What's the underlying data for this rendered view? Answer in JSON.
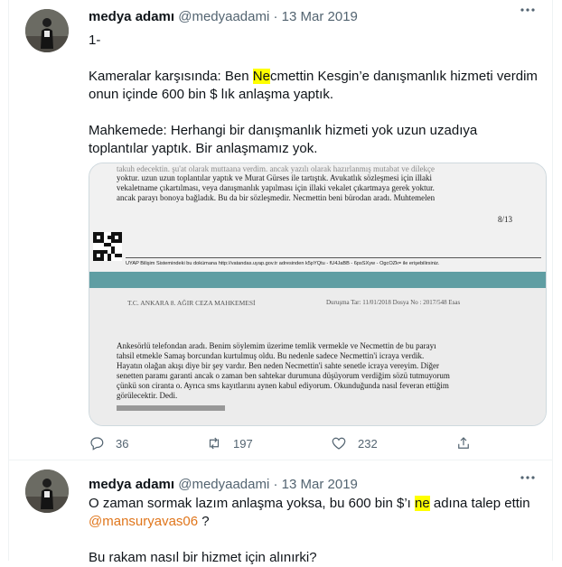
{
  "tweets": [
    {
      "author_name": "medya adamı",
      "author_handle": "@medyaadami",
      "separator": "·",
      "date": "13 Mar 2019",
      "line1": "1-",
      "para1_pre": "Kameralar karşısında: Ben ",
      "para1_hl": "Ne",
      "para1_post": "cmettin Kesgin’e danışmanlık hizmeti verdim onun içinde 600 bin $ lık anlaşma yaptık.",
      "para2": "Mahkemede: Herhangi bir danışmanlık hizmeti yok uzun uzadıya toplantılar yaptık. Bir anlaşmamız yok.",
      "media": {
        "top_lines": [
          "yoktur. uzun uzun toplantılar yaptık ve Murat Gürses ile tartıştık. Avukatlık sözleşmesi için illaki",
          "vekaletname çıkartılması, veya danışmanlık yapılması için illaki vekalet çıkartmaya gerek yoktur.",
          "ancak parayı bonoya bağladık. Bu da bir sözleşmedir. Necmettin beni bürodan aradı. Muhtemelen"
        ],
        "page_number": "8/13",
        "footer_line": "UYAP Bilişim Sistemindeki bu dokümana http://vatandas.uyap.gov.tr adresinden k5pYQtu - fU4JaBB - 6psSXyw - OgcOZk= ile erişebilirsiniz.",
        "court_header": "T.C. ANKARA 8. AĞIR CEZA MAHKEMESİ",
        "case_info": "Duruşma Tar: 11/01/2018 Dosya No : 2017/548 Esas",
        "body_lines": [
          "Ankesörlü telefondan aradı. Benim söylemim üzerime temlik vermekle ve Necmettin de bu parayı",
          "tahsil etmekle Samaş borcundan kurtulmuş oldu. Bu nedenle sadece Necmettin'i icraya verdik.",
          "Hayatın olağan akışı diye bir şey vardır. Ben neden Necmettin'i sahte senetle icraya vereyim. Diğer",
          "senetten paramı garanti ancak o zaman ben sahtekar durumuna düşüyorum verdiğim sözü tutmuyorum",
          "çünkü son ciranta o. Ayrıca sms kayıtlarını aynen kabul ediyorum. Okunduğunda nasıl feveran ettiğim",
          "görülecektir. Dedi."
        ]
      },
      "replies": "36",
      "retweets": "197",
      "likes": "232"
    },
    {
      "author_name": "medya adamı",
      "author_handle": "@medyaadami",
      "separator": "·",
      "date": "13 Mar 2019",
      "text_pre": "O zaman sormak lazım anlaşma yoksa, bu 600 bin $’ı ",
      "text_hl": "ne",
      "text_post": " adına talep ettin",
      "mention": "@mansuryavas06",
      "mention_tail": " ?",
      "line_cut": "Bu rakam nasıl bir hizmet için alınırki?"
    }
  ],
  "colors": {
    "highlight": "#ffff00",
    "mention": "#e0761c",
    "muted": "#536471",
    "doc_band": "#5f9ea3"
  },
  "icons": [
    "more-icon",
    "reply-icon",
    "retweet-icon",
    "like-icon",
    "share-icon"
  ]
}
